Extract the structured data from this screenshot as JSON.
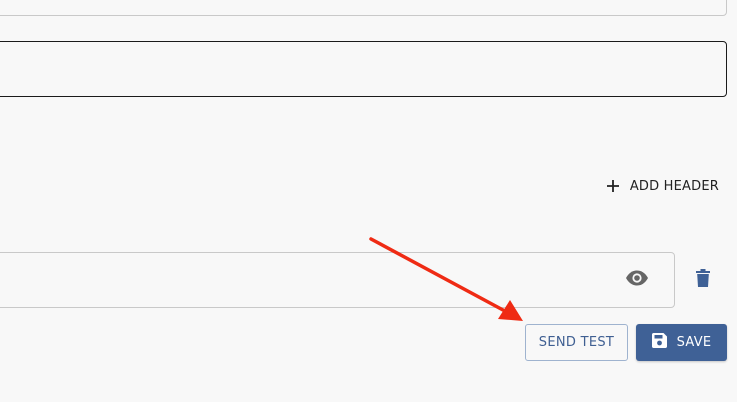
{
  "colors": {
    "primary": "#3f6196",
    "outline_text": "#3f5f92",
    "annotation_arrow": "#ef2b14"
  },
  "headers_section": {
    "add_label": "ADD HEADER",
    "add_icon": "plus-icon"
  },
  "secret_field": {
    "value": "",
    "visibility_icon": "eye-icon",
    "delete_icon": "trash-icon"
  },
  "actions": {
    "send_test_label": "SEND TEST",
    "save_label": "SAVE",
    "save_icon": "floppy-disk-icon"
  }
}
